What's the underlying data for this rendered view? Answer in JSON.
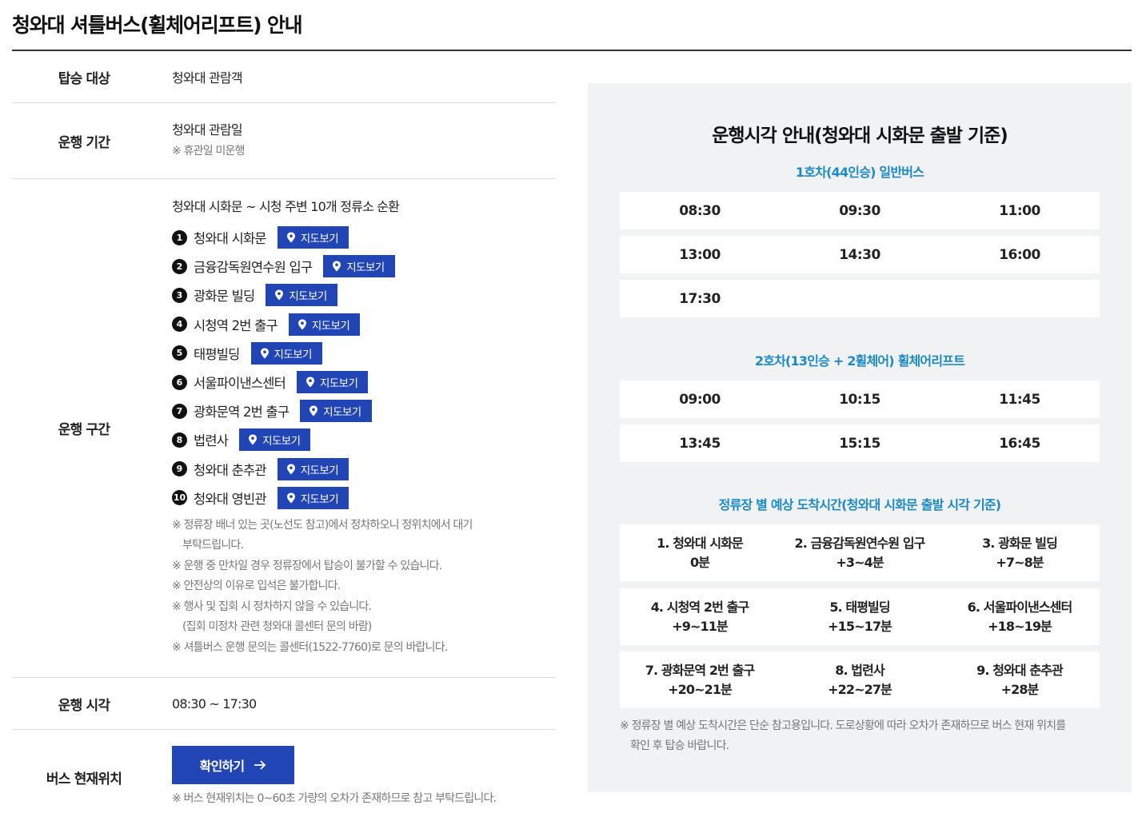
{
  "page": {
    "title": "청와대 셔틀버스(휠체어리프트) 안내"
  },
  "info": {
    "target": {
      "label": "탑승 대상",
      "value": "청와대 관람객"
    },
    "period": {
      "label": "운행 기간",
      "value": "청와대 관람일",
      "note": "※ 휴관일 미운행"
    },
    "route": {
      "label": "운행 구간",
      "summary": "청와대 시화문 ~ 시청 주변 10개 정류소 순환",
      "map_label": "지도보기",
      "stops": [
        {
          "num": "1",
          "name": "청와대 시화문"
        },
        {
          "num": "2",
          "name": "금융감독원연수원 입구"
        },
        {
          "num": "3",
          "name": "광화문 빌딩"
        },
        {
          "num": "4",
          "name": "시청역 2번 출구"
        },
        {
          "num": "5",
          "name": "태평빌딩"
        },
        {
          "num": "6",
          "name": "서울파이낸스센터"
        },
        {
          "num": "7",
          "name": "광화문역 2번 출구"
        },
        {
          "num": "8",
          "name": "법련사"
        },
        {
          "num": "9",
          "name": "청와대 춘추관"
        },
        {
          "num": "10",
          "name": "청와대 영빈관"
        }
      ],
      "notes": [
        "※ 정류장 배너 있는 곳(노선도 참고)에서 정차하오니 정위치에서 대기",
        "부탁드립니다.",
        "※ 운행 중 만차일 경우 정류장에서 탑승이 불가할 수 있습니다.",
        "※ 안전상의 이유로 입석은 불가합니다.",
        "※ 행사 및 집회 시 정차하지 않을 수 있습니다.",
        "(집회 미정차 관련 청와대 콜센터 문의 바람)",
        "※ 셔틀버스 운행 문의는 콜센터(1522-7760)로 문의 바랍니다."
      ]
    },
    "hours": {
      "label": "운행 시각",
      "value": "08:30 ~ 17:30"
    },
    "location": {
      "label": "버스 현재위치",
      "button": "확인하기",
      "note": "※ 버스 현재위치는 0~60초 가량의 오차가 존재하므로 참고 부탁드립니다."
    }
  },
  "schedule": {
    "title": "운행시각 안내(청와대 시화문 출발 기준)",
    "bus1": {
      "name": "1호차(44인승) 일반버스",
      "rows": [
        [
          "08:30",
          "09:30",
          "11:00"
        ],
        [
          "13:00",
          "14:30",
          "16:00"
        ],
        [
          "17:30",
          "",
          ""
        ]
      ]
    },
    "bus2": {
      "name": "2호차(13인승 + 2휠체어) 휠체어리프트",
      "rows": [
        [
          "09:00",
          "10:15",
          "11:45"
        ],
        [
          "13:45",
          "15:15",
          "16:45"
        ]
      ]
    },
    "arrival": {
      "title": "정류장 별 예상 도착시간(청와대 시화문 출발 시각 기준)",
      "rows": [
        [
          {
            "stop": "1. 청와대 시화문",
            "time": "0분"
          },
          {
            "stop": "2. 금융감독원연수원 입구",
            "time": "+3~4분"
          },
          {
            "stop": "3. 광화문 빌딩",
            "time": "+7~8분"
          }
        ],
        [
          {
            "stop": "4. 시청역 2번 출구",
            "time": "+9~11분"
          },
          {
            "stop": "5. 태평빌딩",
            "time": "+15~17분"
          },
          {
            "stop": "6. 서울파이낸스센터",
            "time": "+18~19분"
          }
        ],
        [
          {
            "stop": "7. 광화문역 2번 출구",
            "time": "+20~21분"
          },
          {
            "stop": "8. 법련사",
            "time": "+22~27분"
          },
          {
            "stop": "9. 청와대 춘추관",
            "time": "+28분"
          }
        ]
      ],
      "note1": "※ 정류장 별 예상 도착시간은 단순 참고용입니다. 도로상황에 따라 오차가 존재하므로 버스 현재 위치를",
      "note2": "확인 후 탑승 바랍니다."
    }
  },
  "colors": {
    "accent": "#2245b5",
    "subtitle": "#1b8ac6",
    "panel": "#f1f2f4"
  }
}
